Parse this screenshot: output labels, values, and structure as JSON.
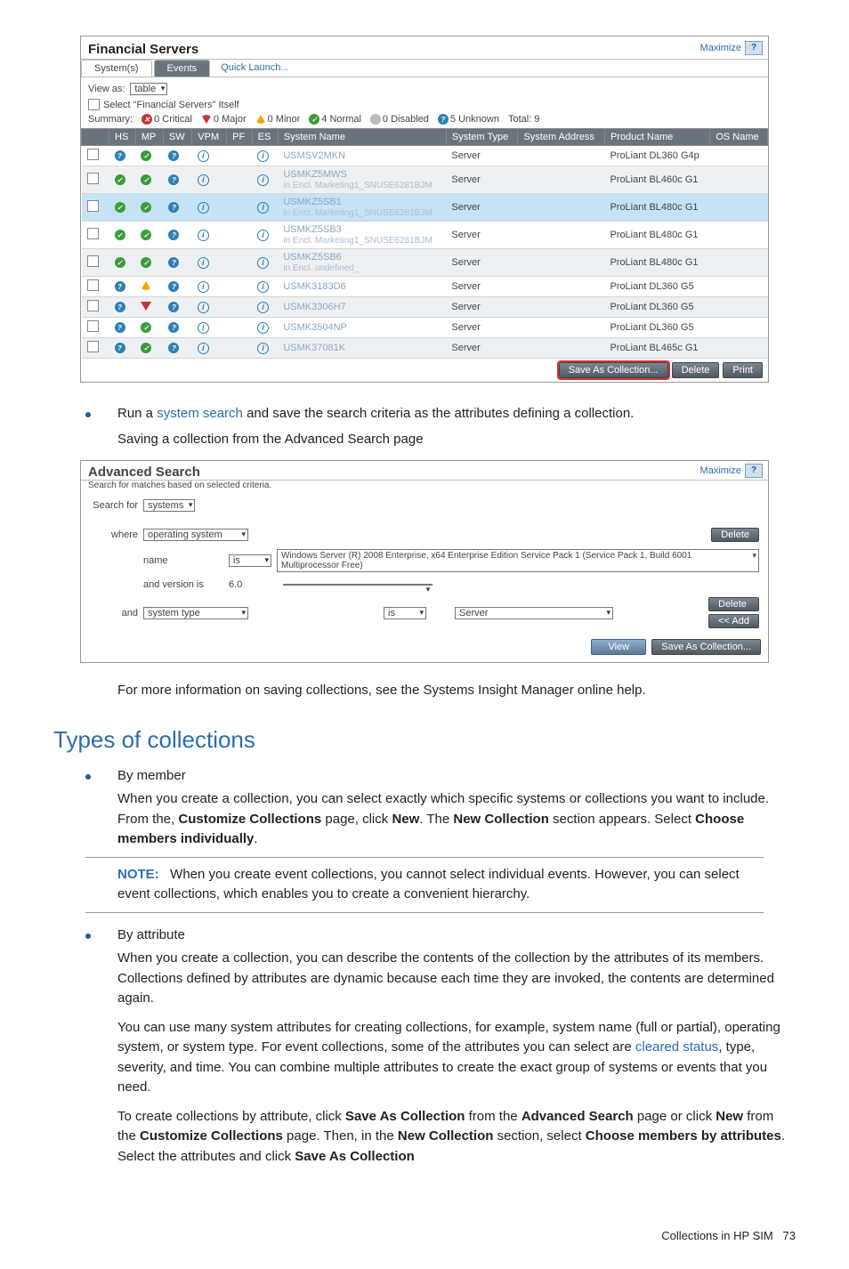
{
  "shot1": {
    "title": "Financial Servers",
    "maximize": "Maximize",
    "help": "?",
    "tabs": {
      "systems": "System(s)",
      "events": "Events"
    },
    "quick": "Quick Launch...",
    "viewas_label": "View as:",
    "viewas_value": "table",
    "select_itself": "Select \"Financial Servers\" Itself",
    "summary": {
      "label": "Summary:",
      "crit": "0 Critical",
      "maj": "0 Major",
      "min": "0 Minor",
      "norm": "4 Normal",
      "dis": "0 Disabled",
      "unk": "5 Unknown",
      "tot": "Total: 9"
    },
    "cols": [
      "HS",
      "MP",
      "SW",
      "VPM",
      "PF",
      "ES",
      "System Name",
      "System Type",
      "System Address",
      "Product Name",
      "OS Name"
    ],
    "rows": [
      {
        "cls": "",
        "hs": "blu",
        "mp": "grn",
        "sw": "blu",
        "name": "USMSV2MKN",
        "note": "",
        "type": "Server",
        "prod": "ProLiant DL360 G4p"
      },
      {
        "cls": "alt",
        "hs": "grn",
        "mp": "grn",
        "sw": "blu",
        "name": "USMKZ5MWS",
        "note": "in Encl. Marketing1_SNUSE6281BJM",
        "type": "Server",
        "prod": "ProLiant BL460c G1"
      },
      {
        "cls": "hi",
        "hs": "grn",
        "mp": "grn",
        "sw": "blu",
        "name": "USMKZ5SB1",
        "note": "in Encl. Marketing1_SNUSE6281BJM",
        "type": "Server",
        "prod": "ProLiant BL480c G1"
      },
      {
        "cls": "",
        "hs": "grn",
        "mp": "grn",
        "sw": "blu",
        "name": "USMKZ5SB3",
        "note": "in Encl. Marketing1_SNUSE6281BJM",
        "type": "Server",
        "prod": "ProLiant BL480c G1"
      },
      {
        "cls": "alt",
        "hs": "grn",
        "mp": "grn",
        "sw": "blu",
        "name": "USMKZ5SB6",
        "note": "in Encl. undefined_",
        "type": "Server",
        "prod": "ProLiant BL480c G1"
      },
      {
        "cls": "",
        "hs": "blu",
        "mp": "ytri",
        "sw": "blu",
        "name": "USMK3183D6",
        "note": "",
        "type": "Server",
        "prod": "ProLiant DL360 G5"
      },
      {
        "cls": "alt",
        "hs": "blu",
        "mp": "red",
        "sw": "blu",
        "name": "USMK3306H7",
        "note": "",
        "type": "Server",
        "prod": "ProLiant DL360 G5"
      },
      {
        "cls": "",
        "hs": "blu",
        "mp": "grn",
        "sw": "blu",
        "name": "USMK3504NP",
        "note": "",
        "type": "Server",
        "prod": "ProLiant DL360 G5"
      },
      {
        "cls": "alt",
        "hs": "blu",
        "mp": "grn",
        "sw": "blu",
        "name": "USMK37081K",
        "note": "",
        "type": "Server",
        "prod": "ProLiant BL465c G1"
      }
    ],
    "buttons": {
      "save": "Save As Collection...",
      "del": "Delete",
      "print": "Print"
    }
  },
  "text": {
    "bullet1a": "Run a ",
    "bullet1_link": "system search",
    "bullet1b": " and save the search criteria as the attributes defining a collection.",
    "saving": "Saving a collection from the Advanced Search page",
    "more": "For more information on saving collections, see the Systems Insight Manager online help.",
    "types_heading": "Types of collections",
    "bymember": "By member",
    "bymember_p_a": "When you create a collection, you can select exactly which specific systems or collections you want to include. From the, ",
    "cc": "Customize Collections",
    "bymember_p_b": " page, click ",
    "new": "New",
    "bymember_p_c": ". The ",
    "newcol": "New Collection",
    "bymember_p_d": " section appears. Select ",
    "choose_ind": "Choose members individually",
    "period": ".",
    "note_label": "NOTE:",
    "note_body": " When you create event collections, you cannot select individual events. However, you can select event collections, which enables you to create a convenient hierarchy.",
    "byattr": "By attribute",
    "byattr_p1": "When you create a collection, you can describe the contents of the collection by the attributes of its members. Collections defined by attributes are dynamic because each time they are invoked, the contents are determined again.",
    "byattr_p2_a": "You can use many system attributes for creating collections, for example, system name (full or partial), operating system, or system type. For event collections, some of the attributes you can select are ",
    "cleared": "cleared status",
    "byattr_p2_b": ", type, severity, and time. You can combine multiple attributes to create the exact group of systems or events that you need.",
    "byattr_p3_a": "To create collections by attribute, click ",
    "sac": "Save As Collection",
    "byattr_p3_b": " from the ",
    "adv": "Advanced Search",
    "byattr_p3_c": " page or click ",
    "byattr_p3_d": " from the ",
    "byattr_p3_e": " page. Then, in the ",
    "byattr_p3_f": " section, select ",
    "choose_attr": "Choose members by attributes",
    "byattr_p3_g": ". Select the attributes and click "
  },
  "shot2": {
    "title": "Advanced Search",
    "sub": "Search for matches based on selected criteria.",
    "searchfor": "Search for",
    "systems": "systems",
    "where": "where",
    "os": "operating system",
    "name": "name",
    "is": "is",
    "os_value": "Windows Server (R) 2008 Enterprise, x64 Enterprise Edition Service Pack 1 (Service Pack 1, Build 6001 Multiprocessor Free)",
    "andver": "and version is",
    "ver": "6.0",
    "and": "and",
    "systype": "system type",
    "server": "Server",
    "del": "Delete",
    "add": "<< Add",
    "view": "View",
    "save": "Save As Collection..."
  },
  "footer": {
    "text": "Collections in HP SIM",
    "page": "73"
  }
}
